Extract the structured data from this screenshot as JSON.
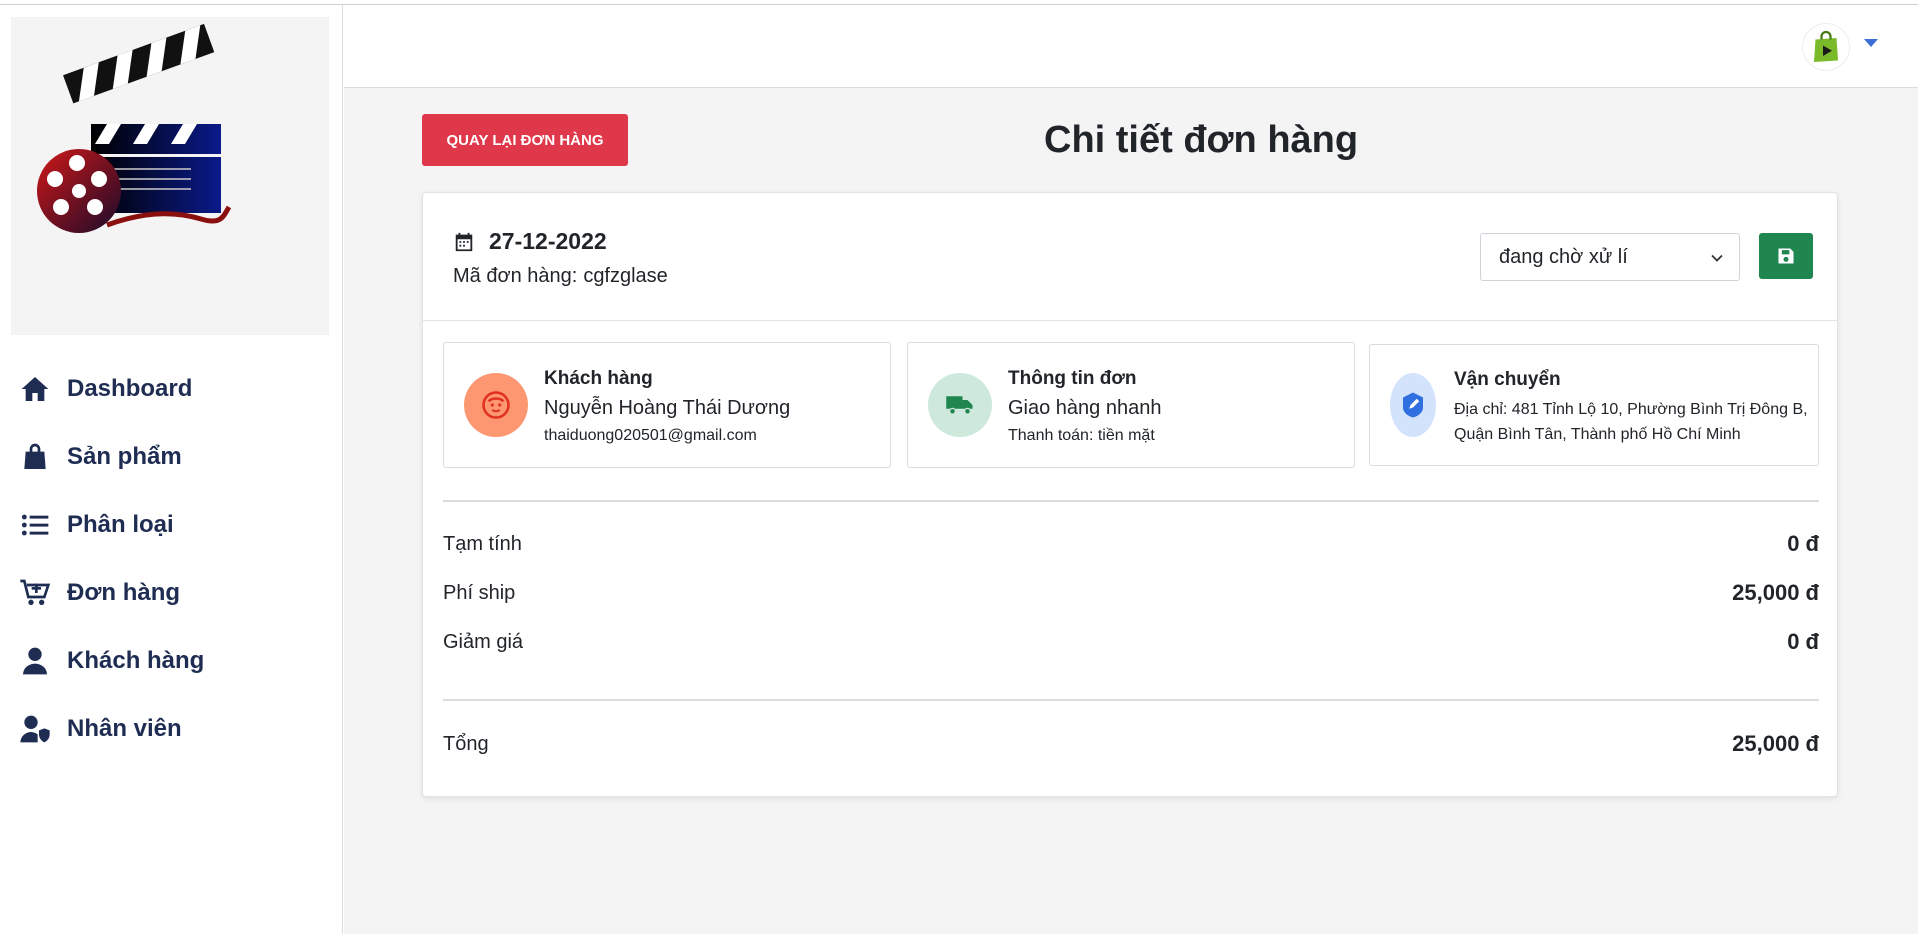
{
  "sidebar": {
    "items": [
      {
        "label": "Dashboard",
        "icon": "home-icon"
      },
      {
        "label": "Sản phẩm",
        "icon": "shopping-bag-icon"
      },
      {
        "label": "Phân loại",
        "icon": "list-icon"
      },
      {
        "label": "Đơn hàng",
        "icon": "cart-plus-icon"
      },
      {
        "label": "Khách hàng",
        "icon": "user-icon"
      },
      {
        "label": "Nhân viên",
        "icon": "user-shield-icon"
      }
    ]
  },
  "header": {
    "back_button": "QUAY LẠI ĐƠN HÀNG",
    "title": "Chi tiết đơn hàng"
  },
  "order": {
    "date": "27-12-2022",
    "code_label": "Mã đơn hàng:",
    "code": "cgfzglase",
    "status": "đang chờ xử lí"
  },
  "customer": {
    "title": "Khách hàng",
    "name": "Nguyễn Hoàng Thái Dương",
    "email": "thaiduong020501@gmail.com"
  },
  "order_info": {
    "title": "Thông tin đơn",
    "shipping_method": "Giao hàng nhanh",
    "payment": "Thanh toán: tiền mặt"
  },
  "shipping": {
    "title": "Vận chuyển",
    "address": "Địa chỉ: 481 Tỉnh Lộ 10, Phường Bình Trị Đông B, Quận Bình Tân, Thành phố Hồ Chí Minh"
  },
  "summary": {
    "subtotal_label": "Tạm tính",
    "subtotal": "0 đ",
    "ship_label": "Phí ship",
    "ship": "25,000 đ",
    "discount_label": "Giảm giá",
    "discount": "0 đ",
    "total_label": "Tổng",
    "total": "25,000 đ"
  },
  "colors": {
    "back_button": "#e0384b",
    "save_button": "#1f8650",
    "nav_text": "#1f2d52",
    "customer_circle": "#fd9772",
    "order_circle": "#cfe8dc",
    "shipping_circle": "#d3e3fb"
  }
}
